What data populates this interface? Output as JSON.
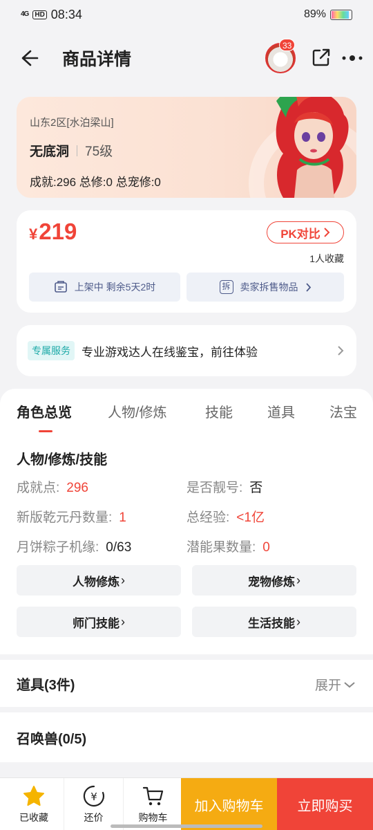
{
  "status_bar": {
    "network": "4G",
    "hd": "HD",
    "time": "08:34",
    "battery": "89%",
    "battery_level": 0.89
  },
  "header": {
    "title": "商品详情",
    "notification_count": "33"
  },
  "hero": {
    "server": "山东2区[水泊梁山]",
    "role_name": "无底洞",
    "level": "75级",
    "stats": "成就:296 总修:0 总宠修:0"
  },
  "price_card": {
    "currency": "¥",
    "price": "219",
    "pk_label": "PK对比",
    "favorites": "1人收藏",
    "listing_status": "上架中 剩余5天2时",
    "split_icon_text": "拆",
    "split_sale": "卖家拆售物品"
  },
  "service": {
    "tag": "专属服务",
    "text": "专业游戏达人在线鉴宝，前往体验"
  },
  "tabs": [
    "角色总览",
    "人物/修炼",
    "技能",
    "道具",
    "法宝"
  ],
  "overview": {
    "section_title": "人物/修炼/技能",
    "rows": [
      {
        "label": "成就点:",
        "value": "296"
      },
      {
        "label": "是否靓号:",
        "value": "否"
      },
      {
        "label": "新版乾元丹数量:",
        "value": "1"
      },
      {
        "label": "总经验:",
        "value": "<1亿"
      },
      {
        "label": "月饼粽子机缘:",
        "value": "0/63"
      },
      {
        "label": "潜能果数量:",
        "value": "0"
      }
    ],
    "buttons": [
      "人物修炼",
      "宠物修炼",
      "师门技能",
      "生活技能"
    ]
  },
  "items_section": {
    "title": "道具(3件)",
    "expand_label": "展开"
  },
  "pets_section": {
    "title": "召唤兽(0/5)"
  },
  "bottom_bar": {
    "favorite_label": "已收藏",
    "bargain_label": "还价",
    "bargain_icon_text": "¥",
    "cart_label": "购物车",
    "add_to_cart": "加入购物车",
    "buy_now": "立即购买"
  },
  "colors": {
    "accent": "#f04438",
    "cart_button": "#f5ab12",
    "service_tag": "#1eaaa8",
    "star": "#f5b400"
  }
}
